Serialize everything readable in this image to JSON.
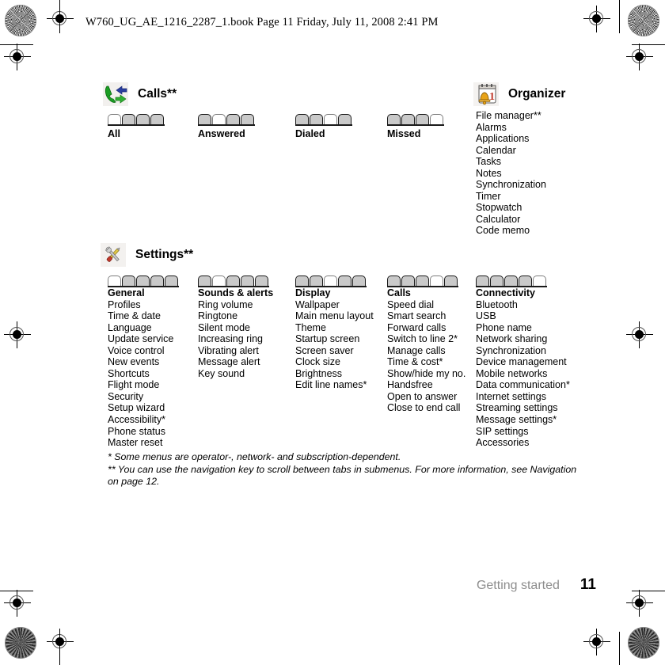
{
  "document": {
    "header_line": "W760_UG_AE_1216_2287_1.book  Page 11  Friday, July 11, 2008  2:41 PM",
    "footer_chapter": "Getting started",
    "page_number": "11"
  },
  "sections": {
    "calls": {
      "icon": "calls-icon",
      "title": "Calls**",
      "tab_groups": [
        {
          "label": "All",
          "count": 4,
          "selected": 1
        },
        {
          "label": "Answered",
          "count": 4,
          "selected": 2
        },
        {
          "label": "Dialed",
          "count": 4,
          "selected": 3
        },
        {
          "label": "Missed",
          "count": 4,
          "selected": 4
        }
      ]
    },
    "organizer": {
      "icon": "organizer-icon",
      "title": "Organizer",
      "items": [
        "File manager**",
        "Alarms",
        "Applications",
        "Calendar",
        "Tasks",
        "Notes",
        "Synchronization",
        "Timer",
        "Stopwatch",
        "Calculator",
        "Code memo"
      ]
    },
    "settings": {
      "icon": "settings-icon",
      "title": "Settings**",
      "columns": [
        {
          "title": "General",
          "tabs": {
            "count": 5,
            "selected": 1
          },
          "items": [
            "Profiles",
            "Time & date",
            "Language",
            "Update service",
            "Voice control",
            "New events",
            "Shortcuts",
            "Flight mode",
            "Security",
            "Setup wizard",
            "Accessibility*",
            "Phone status",
            "Master reset"
          ]
        },
        {
          "title": "Sounds & alerts",
          "tabs": {
            "count": 5,
            "selected": 2
          },
          "items": [
            "Ring volume",
            "Ringtone",
            "Silent mode",
            "Increasing ring",
            "Vibrating alert",
            "Message alert",
            "Key sound"
          ]
        },
        {
          "title": "Display",
          "tabs": {
            "count": 5,
            "selected": 3
          },
          "items": [
            "Wallpaper",
            "Main menu layout",
            "Theme",
            "Startup screen",
            "Screen saver",
            "Clock size",
            "Brightness",
            "Edit line names*"
          ]
        },
        {
          "title": "Calls",
          "tabs": {
            "count": 5,
            "selected": 4
          },
          "items": [
            "Speed dial",
            "Smart search",
            "Forward calls",
            "Switch to line 2*",
            "Manage calls",
            "Time & cost*",
            "Show/hide my no.",
            "Handsfree",
            "Open to answer",
            "Close to end call"
          ]
        },
        {
          "title": "Connectivity",
          "tabs": {
            "count": 5,
            "selected": 5
          },
          "items": [
            "Bluetooth",
            "USB",
            "Phone name",
            "Network sharing",
            "Synchronization",
            "Device management",
            "Mobile networks",
            "Data communication*",
            "Internet settings",
            "Streaming settings",
            "Message settings*",
            "SIP settings",
            "Accessories"
          ]
        }
      ]
    }
  },
  "footnotes": [
    "* Some menus are operator-, network- and subscription-dependent.",
    "** You can use the navigation key to scroll between tabs in submenus. For more information, see Navigation on page 12."
  ],
  "colors": {
    "tab_fill": "#c9c9c9",
    "tab_selected_fill": "#ffffff",
    "tab_border": "#1a1a1a",
    "footer_chapter": "#8d8d8d",
    "calls_handset_green": "#17a01e",
    "calls_arrow_blue": "#2b3fa0",
    "calls_arrow_green": "#2fae31",
    "organizer_bell": "#e8a317",
    "settings_wrench": "#b8b8b8",
    "settings_screwdriver": "#c0392b"
  }
}
